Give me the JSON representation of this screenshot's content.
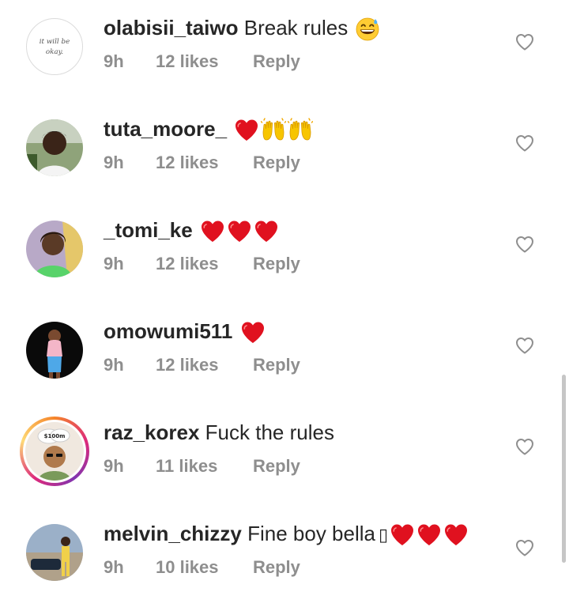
{
  "comments": [
    {
      "username": "olabisii_taiwo",
      "text": "Break rules",
      "emojis": [
        "grinning-sweat-emoji"
      ],
      "avatar_text": "it will be okay.",
      "time": "9h",
      "likes": "12 likes",
      "reply": "Reply"
    },
    {
      "username": "tuta_moore_",
      "text": "",
      "emojis": [
        "red-heart-emoji",
        "raised-hands-emoji",
        "raised-hands-emoji"
      ],
      "time": "9h",
      "likes": "12 likes",
      "reply": "Reply"
    },
    {
      "username": "_tomi_ke",
      "text": "",
      "emojis": [
        "red-heart-emoji",
        "red-heart-emoji",
        "red-heart-emoji"
      ],
      "time": "9h",
      "likes": "12 likes",
      "reply": "Reply"
    },
    {
      "username": "omowumi511",
      "text": "",
      "emojis": [
        "red-heart-emoji"
      ],
      "time": "9h",
      "likes": "12 likes",
      "reply": "Reply"
    },
    {
      "username": "raz_korex",
      "text": "Fuck the rules",
      "emojis": [],
      "avatar_text": "$100m",
      "time": "9h",
      "likes": "11 likes",
      "reply": "Reply"
    },
    {
      "username": "melvin_chizzy",
      "text": "Fine boy bella",
      "missing_glyph": "▯",
      "emojis": [
        "red-heart-emoji",
        "red-heart-emoji",
        "red-heart-emoji"
      ],
      "time": "9h",
      "likes": "10 likes",
      "reply": "Reply"
    }
  ],
  "colors": {
    "text": "#262626",
    "meta": "#8e8e8e",
    "heart_red": "#e0111f",
    "scrollbar": "#c6c6c6"
  }
}
